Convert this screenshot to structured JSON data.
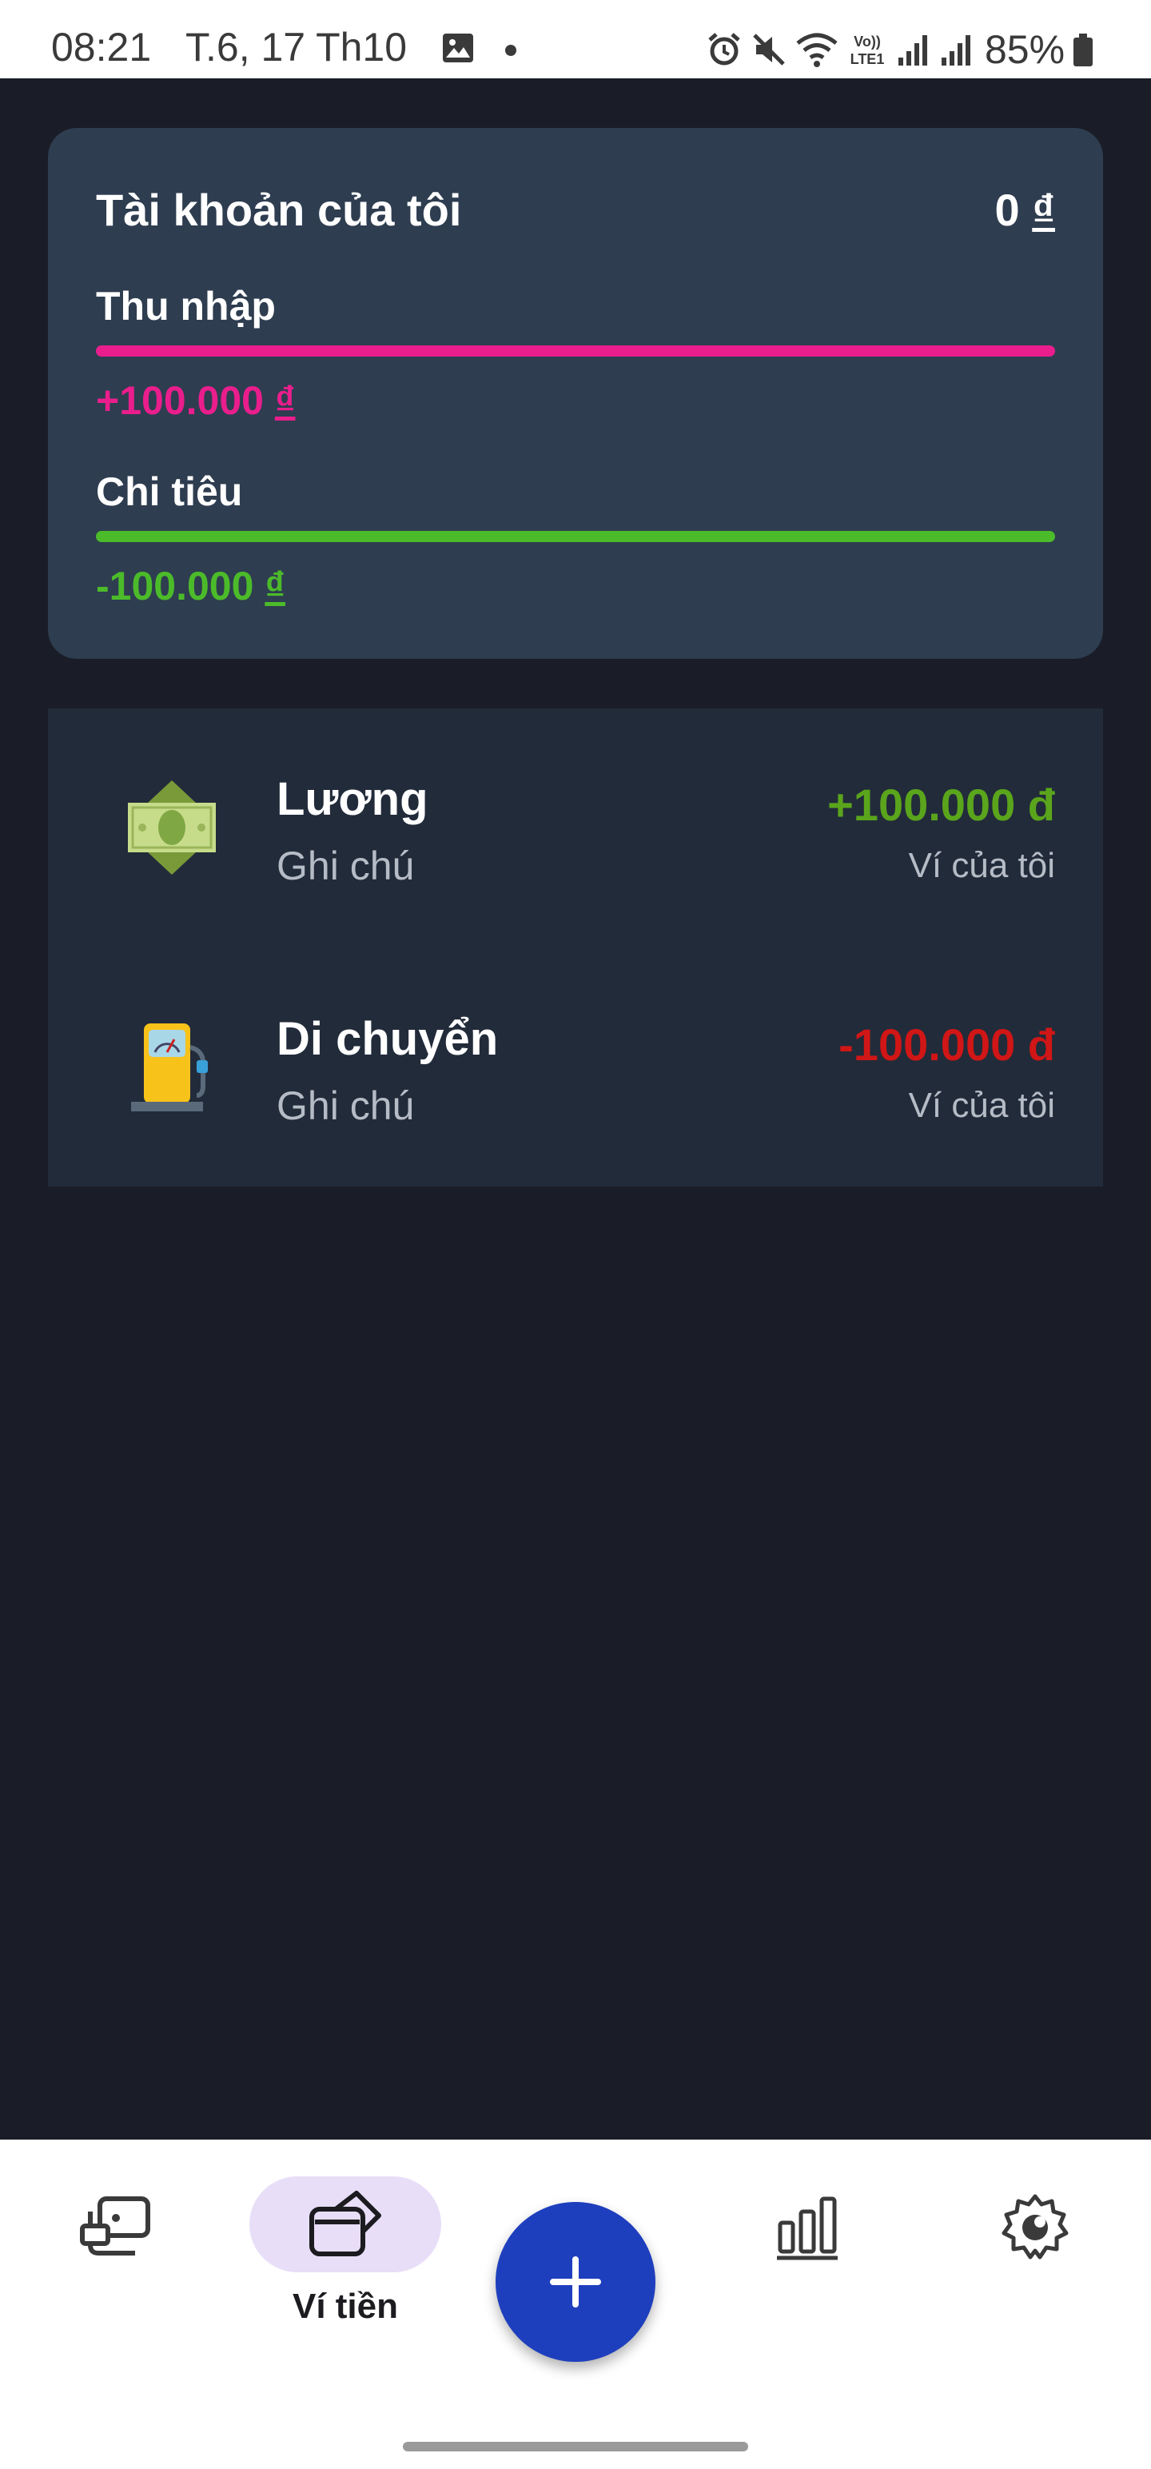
{
  "status_bar": {
    "time": "08:21",
    "date": "T.6, 17 Th10",
    "battery": "85%",
    "icons": [
      "gallery-icon",
      "alarm-icon",
      "mute-icon",
      "wifi-icon",
      "volte-icon",
      "signal-icon",
      "signal-icon",
      "battery-icon"
    ]
  },
  "account": {
    "title": "Tài khoản của tôi",
    "balance": "0",
    "currency": "₫",
    "income_label": "Thu nhập",
    "income_amount": "+100.000",
    "income_progress": 1.0,
    "expense_label": "Chi tiêu",
    "expense_amount": "-100.000",
    "expense_progress": 1.0,
    "colors": {
      "income": "#e91e8c",
      "expense": "#4cbb2a",
      "card": "#2e3d50"
    }
  },
  "transactions": [
    {
      "name": "Lương",
      "note": "Ghi chú",
      "amount": "+100.000 đ",
      "wallet": "Ví của tôi",
      "icon": "money-icon",
      "color": "#5aa51c"
    },
    {
      "name": "Di chuyển",
      "note": "Ghi chú",
      "amount": "-100.000 đ",
      "wallet": "Ví của tôi",
      "icon": "fuel-pump-icon",
      "color": "#d01616"
    }
  ],
  "bottom_nav": {
    "items": [
      {
        "icon": "transactions-icon"
      },
      {
        "icon": "wallet-icon",
        "label": "Ví tiền",
        "active": true
      },
      {
        "icon": "add-icon"
      },
      {
        "icon": "chart-icon"
      },
      {
        "icon": "settings-icon"
      }
    ]
  }
}
